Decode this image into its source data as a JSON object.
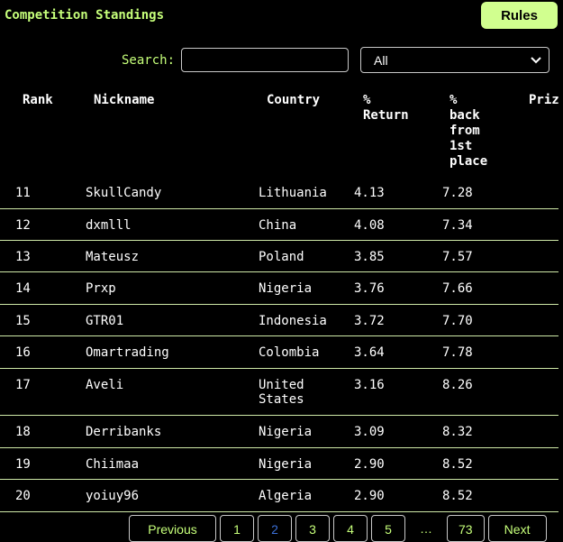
{
  "header": {
    "title": "Competition Standings",
    "rules_label": "Rules"
  },
  "search": {
    "label": "Search:",
    "value": "",
    "placeholder": ""
  },
  "filter": {
    "selected": "All"
  },
  "table": {
    "columns": [
      "Rank",
      "Nickname",
      "Country",
      "% Return",
      "% back from 1st place",
      "Priz"
    ],
    "rows": [
      {
        "rank": "11",
        "nickname": "SkullCandy",
        "country": "Lithuania",
        "return": "4.13",
        "back": "7.28"
      },
      {
        "rank": "12",
        "nickname": "dxmlll",
        "country": "China",
        "return": "4.08",
        "back": "7.34"
      },
      {
        "rank": "13",
        "nickname": "Mateusz",
        "country": "Poland",
        "return": "3.85",
        "back": "7.57"
      },
      {
        "rank": "14",
        "nickname": "Prxp",
        "country": "Nigeria",
        "return": "3.76",
        "back": "7.66"
      },
      {
        "rank": "15",
        "nickname": "GTR01",
        "country": "Indonesia",
        "return": "3.72",
        "back": "7.70"
      },
      {
        "rank": "16",
        "nickname": "Omartrading",
        "country": "Colombia",
        "return": "3.64",
        "back": "7.78"
      },
      {
        "rank": "17",
        "nickname": "Aveli",
        "country": "United States",
        "return": "3.16",
        "back": "8.26"
      },
      {
        "rank": "18",
        "nickname": "Derribanks",
        "country": "Nigeria",
        "return": "3.09",
        "back": "8.32"
      },
      {
        "rank": "19",
        "nickname": "Chiimaa",
        "country": "Nigeria",
        "return": "2.90",
        "back": "8.52"
      },
      {
        "rank": "20",
        "nickname": "yoiuy96",
        "country": "Algeria",
        "return": "2.90",
        "back": "8.52"
      }
    ]
  },
  "pagination": {
    "previous": "Previous",
    "pages": [
      "1",
      "2",
      "3",
      "4",
      "5"
    ],
    "ellipsis": "…",
    "last": "73",
    "next": "Next",
    "current": "2"
  },
  "colors": {
    "accent": "#c6ff7a",
    "button_bg": "#d1ff8f",
    "active_page": "#3b6fd6",
    "background": "#000000"
  }
}
